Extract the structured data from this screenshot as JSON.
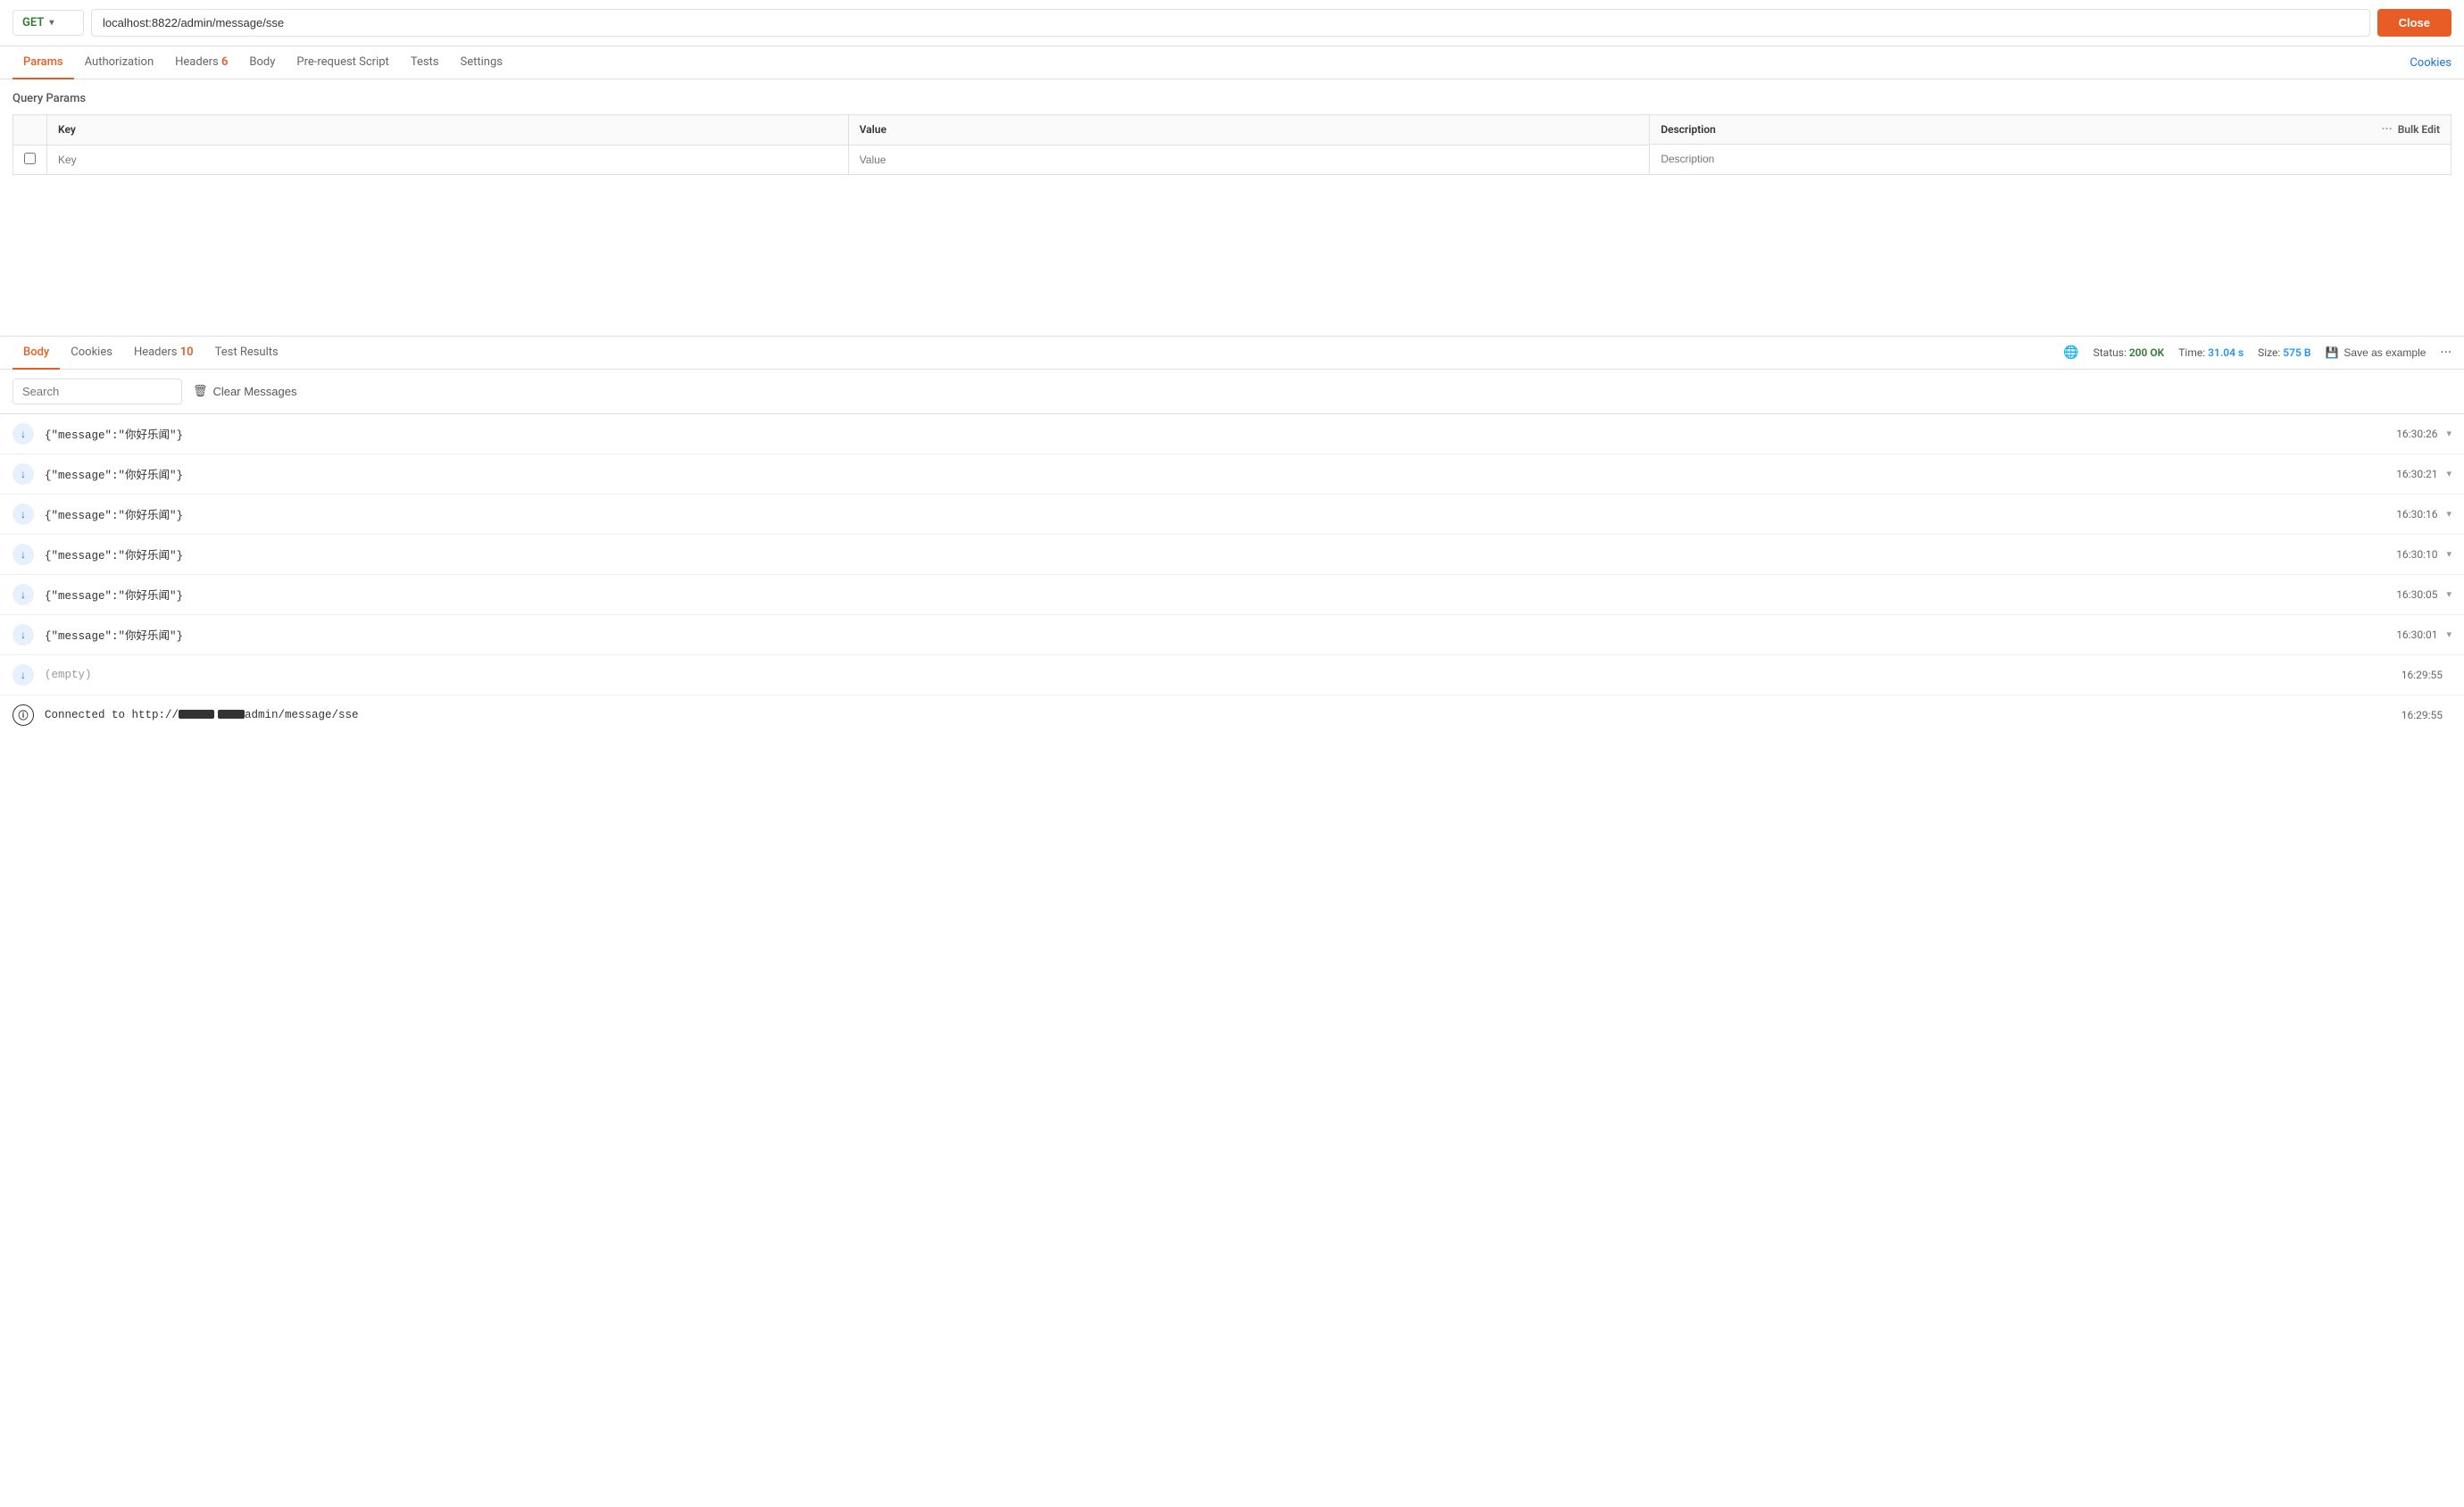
{
  "urlBar": {
    "method": "GET",
    "url": "localhost:8822/admin/message/sse",
    "closeLabel": "Close"
  },
  "topTabs": {
    "items": [
      {
        "label": "Params",
        "active": true,
        "badge": null
      },
      {
        "label": "Authorization",
        "active": false,
        "badge": null
      },
      {
        "label": "Headers",
        "active": false,
        "badge": "6"
      },
      {
        "label": "Body",
        "active": false,
        "badge": null
      },
      {
        "label": "Pre-request Script",
        "active": false,
        "badge": null
      },
      {
        "label": "Tests",
        "active": false,
        "badge": null
      },
      {
        "label": "Settings",
        "active": false,
        "badge": null
      }
    ],
    "cookiesLabel": "Cookies"
  },
  "queryParams": {
    "title": "Query Params",
    "columns": [
      "Key",
      "Value",
      "Description",
      "Bulk Edit"
    ],
    "placeholder": {
      "key": "Key",
      "value": "Value",
      "description": "Description"
    }
  },
  "responseTabs": {
    "items": [
      {
        "label": "Body",
        "active": true,
        "badge": null
      },
      {
        "label": "Cookies",
        "active": false,
        "badge": null
      },
      {
        "label": "Headers",
        "active": false,
        "badge": "10"
      },
      {
        "label": "Test Results",
        "active": false,
        "badge": null
      }
    ],
    "status": {
      "label": "Status:",
      "value": "200 OK"
    },
    "time": {
      "label": "Time:",
      "value": "31.04 s"
    },
    "size": {
      "label": "Size:",
      "value": "575 B"
    },
    "saveExampleLabel": "Save as example",
    "moreOptions": "···"
  },
  "messageToolbar": {
    "searchPlaceholder": "Search",
    "clearLabel": "Clear Messages"
  },
  "messages": [
    {
      "content": "{\"message\":\"你好乐闻\"}",
      "time": "16:30:26",
      "empty": false,
      "isInfo": false
    },
    {
      "content": "{\"message\":\"你好乐闻\"}",
      "time": "16:30:21",
      "empty": false,
      "isInfo": false
    },
    {
      "content": "{\"message\":\"你好乐闻\"}",
      "time": "16:30:16",
      "empty": false,
      "isInfo": false
    },
    {
      "content": "{\"message\":\"你好乐闻\"}",
      "time": "16:30:10",
      "empty": false,
      "isInfo": false
    },
    {
      "content": "{\"message\":\"你好乐闻\"}",
      "time": "16:30:05",
      "empty": false,
      "isInfo": false
    },
    {
      "content": "{\"message\":\"你好乐闻\"}",
      "time": "16:30:01",
      "empty": false,
      "isInfo": false
    },
    {
      "content": "(empty)",
      "time": "16:29:55",
      "empty": true,
      "isInfo": false
    },
    {
      "content": "Connected to http://",
      "time": "16:29:55",
      "empty": false,
      "isInfo": true,
      "redacted": true,
      "suffix": "admin/message/sse"
    }
  ]
}
